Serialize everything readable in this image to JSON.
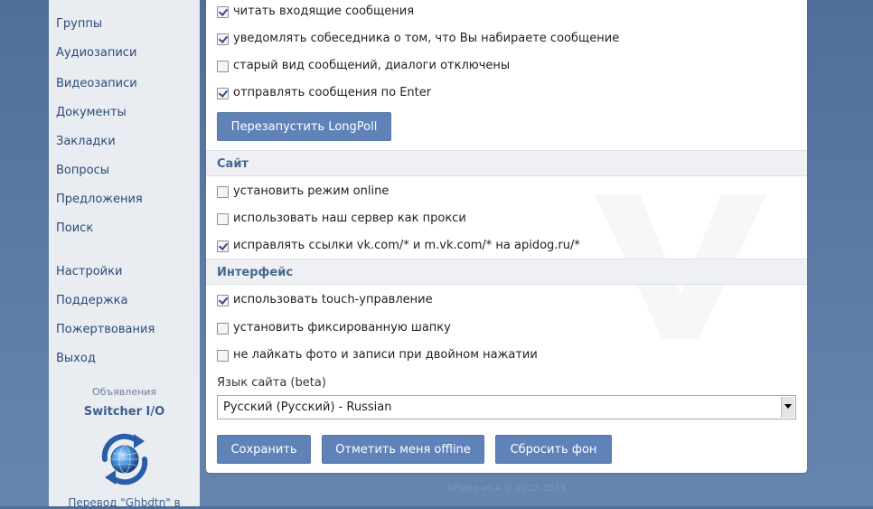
{
  "sidebar": {
    "nav_items": [
      {
        "label": "Группы"
      },
      {
        "label": "Аудиозаписи"
      },
      {
        "label": "Видеозаписи"
      },
      {
        "label": "Документы"
      },
      {
        "label": "Закладки"
      },
      {
        "label": "Вопросы"
      },
      {
        "label": "Предложения"
      },
      {
        "label": "Поиск"
      },
      {
        "label": "Настройки"
      },
      {
        "label": "Поддержка"
      },
      {
        "label": "Пожертвования"
      },
      {
        "label": "Выход"
      }
    ],
    "promo": {
      "caption": "Объявления",
      "title": "Switcher I/O",
      "footer_text": "Перевод \"Ghbdtn\" в"
    }
  },
  "messages_options": [
    {
      "label": "читать входящие сообщения",
      "checked": true
    },
    {
      "label": "уведомлять собеседника о том, что Вы набираете сообщение",
      "checked": true
    },
    {
      "label": "старый вид сообщений, диалоги отключены",
      "checked": false
    },
    {
      "label": "отправлять сообщения по Enter",
      "checked": true
    }
  ],
  "restart_button": "Перезапустить LongPoll",
  "site_section": {
    "title": "Сайт",
    "options": [
      {
        "label": "установить режим online",
        "checked": false
      },
      {
        "label": "использовать наш сервер как прокси",
        "checked": false
      },
      {
        "label": "исправлять ссылки vk.com/* и m.vk.com/* на apidog.ru/*",
        "checked": true
      }
    ]
  },
  "interface_section": {
    "title": "Интерфейс",
    "options": [
      {
        "label": "использовать touch-управление",
        "checked": true
      },
      {
        "label": "установить фиксированную шапку",
        "checked": false
      },
      {
        "label": "не лайкать фото и записи при двойном нажатии",
        "checked": false
      }
    ],
    "language_label": "Язык сайта (beta)",
    "language_value": "Русский (Русский) - Russian"
  },
  "actions": {
    "save": "Сохранить",
    "offline": "Отметить меня offline",
    "reset_bg": "Сбросить фон"
  },
  "footer": "APIdog v6.4 © 2012–2015",
  "colors": {
    "accent": "#5f83b9",
    "link": "#2b4a78",
    "section_title": "#45688e"
  }
}
